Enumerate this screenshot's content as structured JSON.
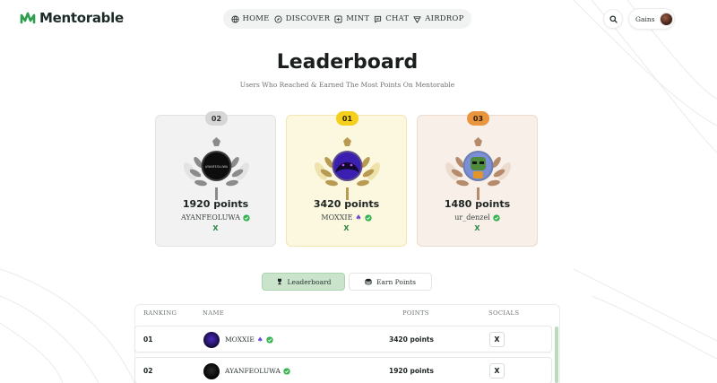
{
  "brand": {
    "name": "Mentorable",
    "accent": "#2f9e4f"
  },
  "nav": {
    "items": [
      {
        "label": "HOME",
        "icon": "globe-icon"
      },
      {
        "label": "DISCOVER",
        "icon": "compass-icon"
      },
      {
        "label": "MINT",
        "icon": "plus-square-icon"
      },
      {
        "label": "CHAT",
        "icon": "chat-icon"
      },
      {
        "label": "AIRDROP",
        "icon": "airdrop-icon"
      }
    ]
  },
  "header": {
    "search_icon": "search-icon",
    "profile_name": "Gains"
  },
  "page": {
    "title": "Leaderboard",
    "subtitle": "Users Who Reached & Earned The Most Points On Mentorable"
  },
  "podium": [
    {
      "rank": "02",
      "points": "1920 points",
      "user": "AYANFEOLUWA",
      "social": "X",
      "tier": "silver",
      "color": "#d6d6d6"
    },
    {
      "rank": "01",
      "points": "3420 points",
      "user": "MOXXIE",
      "user_suffix": "♠",
      "social": "X",
      "tier": "gold",
      "color": "#f4cf1b"
    },
    {
      "rank": "03",
      "points": "1480 points",
      "user": "ur_denzel",
      "social": "X",
      "tier": "bronze",
      "color": "#e9953e"
    }
  ],
  "tabs": [
    {
      "label": "Leaderboard",
      "active": true,
      "icon": "trophy-icon"
    },
    {
      "label": "Earn Points",
      "active": false,
      "icon": "coins-icon"
    }
  ],
  "table": {
    "headers": {
      "ranking": "RANKING",
      "name": "NAME",
      "points": "POINTS",
      "socials": "SOCIALS"
    },
    "rows": [
      {
        "rank": "01",
        "name": "MOXXIE",
        "name_suffix": "♠",
        "points": "3420 points",
        "social": "X"
      },
      {
        "rank": "02",
        "name": "AYANFEOLUWA",
        "name_suffix": "",
        "points": "1920 points",
        "social": "X"
      }
    ]
  }
}
